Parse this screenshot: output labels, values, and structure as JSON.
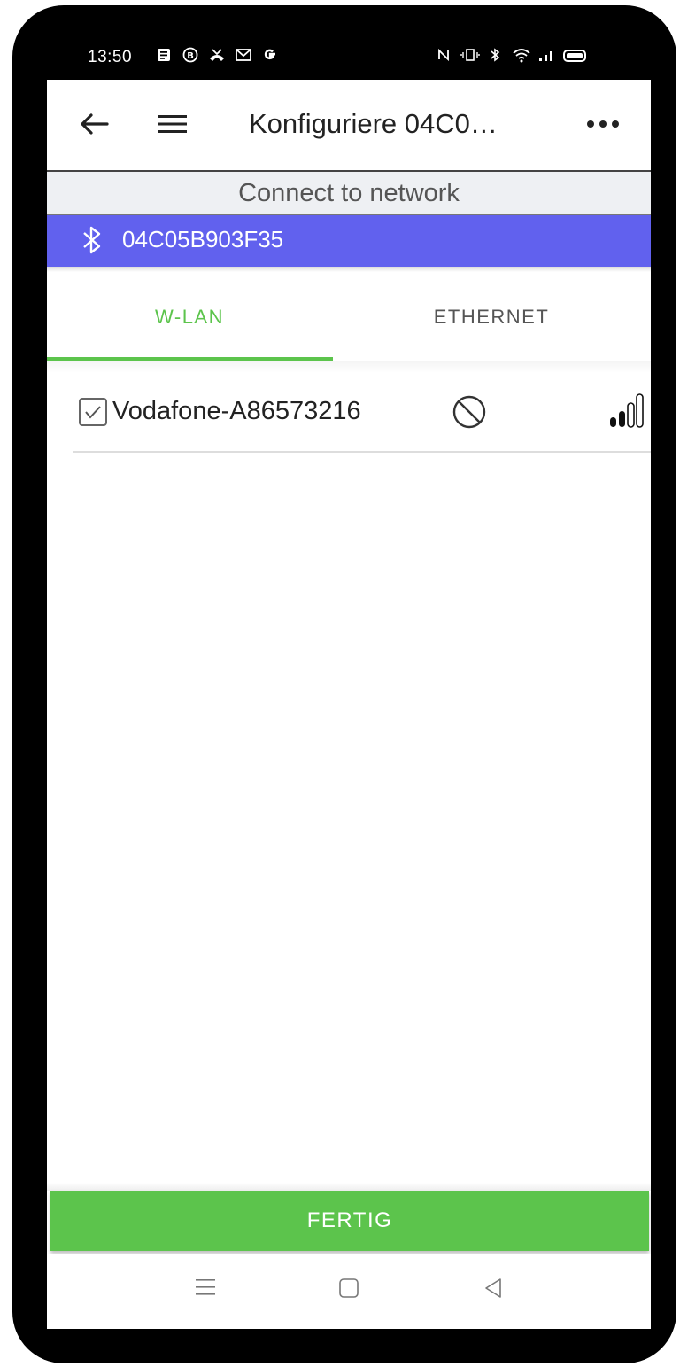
{
  "status_bar": {
    "time": "13:50",
    "left_icons": [
      "note-icon",
      "b-icon",
      "missed-call-icon",
      "gmail-icon",
      "google-icon"
    ],
    "right_icons": [
      "nfc-icon",
      "vibrate-icon",
      "bluetooth-icon",
      "wifi-icon",
      "cell-signal-icon",
      "battery-icon"
    ]
  },
  "app_bar": {
    "title": "Konfiguriere 04C0…",
    "more_label": "•••"
  },
  "connect_bar": {
    "label": "Connect to network"
  },
  "device": {
    "name": "04C05B903F35",
    "color": "#6161ee"
  },
  "tabs": [
    {
      "label": "W-LAN",
      "active": true
    },
    {
      "label": "ETHERNET",
      "active": false
    }
  ],
  "networks": [
    {
      "name": "Vodafone-A86573216",
      "checked": true,
      "signal_bars_filled": 2,
      "signal_bars_total": 4
    }
  ],
  "done_button": {
    "label": "FERTIG",
    "color": "#5cc44c"
  },
  "colors": {
    "accent": "#5cc44c",
    "device_bar": "#6161ee"
  }
}
